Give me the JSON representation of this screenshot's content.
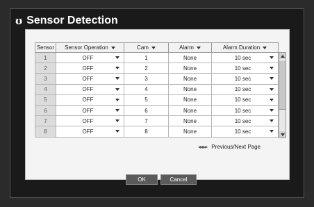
{
  "window": {
    "title": "Sensor Detection",
    "logo_glyph": "ʊ"
  },
  "table": {
    "headers": [
      "Sensor",
      "Sensor Operation",
      "Cam",
      "Alarm",
      "Alarm Duration"
    ],
    "rows": [
      {
        "sensor": "1",
        "operation": "OFF",
        "cam": "1",
        "alarm": "None",
        "duration": "10 sec"
      },
      {
        "sensor": "2",
        "operation": "OFF",
        "cam": "2",
        "alarm": "None",
        "duration": "10 sec"
      },
      {
        "sensor": "3",
        "operation": "OFF",
        "cam": "3",
        "alarm": "None",
        "duration": "10 sec"
      },
      {
        "sensor": "4",
        "operation": "OFF",
        "cam": "4",
        "alarm": "None",
        "duration": "10 sec"
      },
      {
        "sensor": "5",
        "operation": "OFF",
        "cam": "5",
        "alarm": "None",
        "duration": "10 sec"
      },
      {
        "sensor": "6",
        "operation": "OFF",
        "cam": "6",
        "alarm": "None",
        "duration": "10 sec"
      },
      {
        "sensor": "7",
        "operation": "OFF",
        "cam": "7",
        "alarm": "None",
        "duration": "10 sec"
      },
      {
        "sensor": "8",
        "operation": "OFF",
        "cam": "8",
        "alarm": "None",
        "duration": "10 sec"
      }
    ]
  },
  "pager": {
    "arrows": "◂◂ ▸▸",
    "label": "Previous/Next Page"
  },
  "buttons": {
    "ok": "OK",
    "cancel": "Cancel"
  }
}
